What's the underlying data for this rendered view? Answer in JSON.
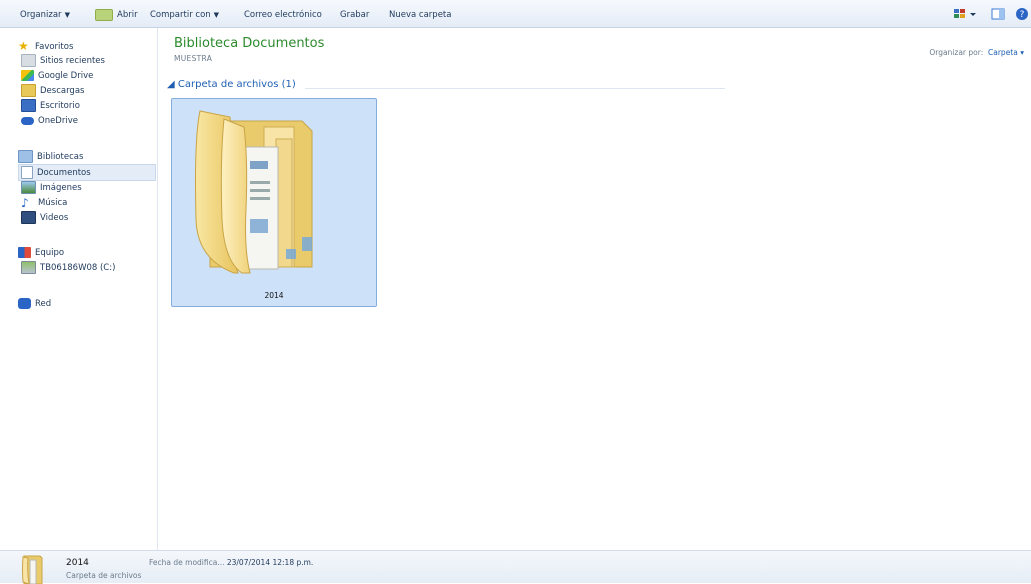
{
  "toolbar": {
    "organize": "Organizar",
    "open": "Abrir",
    "share": "Compartir con",
    "email": "Correo electrónico",
    "burn": "Grabar",
    "new_folder": "Nueva carpeta"
  },
  "nav": {
    "favorites": "Favoritos",
    "recent": "Sitios recientes",
    "gdrive": "Google Drive",
    "downloads": "Descargas",
    "desktop": "Escritorio",
    "onedrive": "OneDrive",
    "libraries": "Bibliotecas",
    "documents": "Documentos",
    "images": "Imágenes",
    "music": "Música",
    "videos": "Videos",
    "computer": "Equipo",
    "drive": "TB06186W08 (C:)",
    "network": "Red"
  },
  "main": {
    "title": "Biblioteca Documentos",
    "subtitle": "MUESTRA",
    "arrange_label": "Organizar por:",
    "arrange_value": "Carpeta",
    "group": "Carpeta de archivos (1)",
    "folder_name": "2014"
  },
  "status": {
    "name": "2014",
    "type": "Carpeta de archivos",
    "date_label": "Fecha de modifica...",
    "date_value": "23/07/2014 12:18 p.m."
  },
  "colors": {
    "title_green": "#2c8a2c",
    "link_blue": "#1e5fb3",
    "selection": "#cde2f8"
  }
}
